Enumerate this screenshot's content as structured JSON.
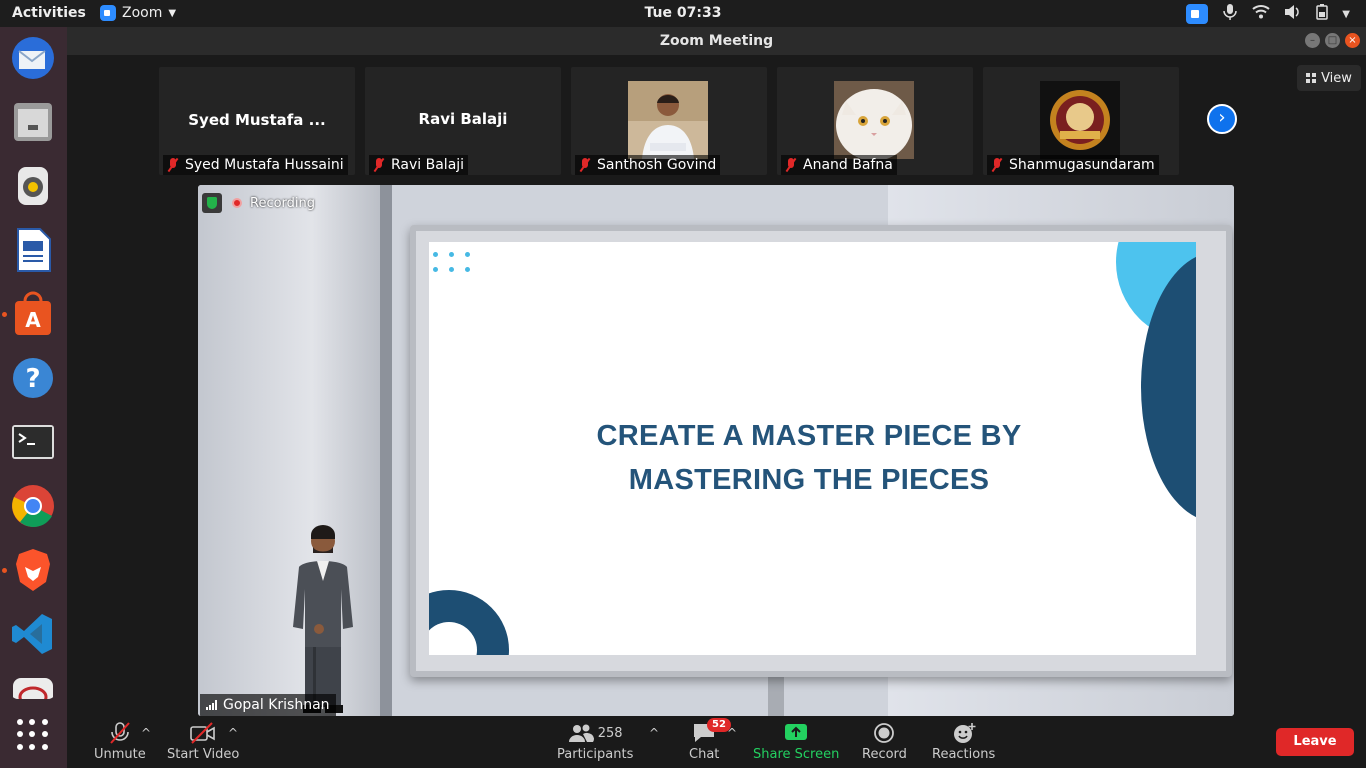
{
  "system_bar": {
    "activities": "Activities",
    "app_name": "Zoom",
    "clock": "Tue 07:33"
  },
  "window": {
    "title": "Zoom Meeting"
  },
  "view_button": "View",
  "participants_strip": [
    {
      "display_name": "Syed Mustafa ...",
      "label": "Syed Mustafa Hussaini",
      "muted": true
    },
    {
      "display_name": "Ravi Balaji",
      "label": "Ravi Balaji",
      "muted": true
    },
    {
      "display_name": "",
      "label": "Santhosh Govind",
      "muted": true
    },
    {
      "display_name": "",
      "label": "Anand Bafna",
      "muted": true
    },
    {
      "display_name": "",
      "label": "Shanmugasundaram",
      "muted": true
    }
  ],
  "stage": {
    "recording_label": "Recording",
    "slide_line1": "CREATE A MASTER PIECE BY",
    "slide_line2": "MASTERING THE PIECES",
    "speaker_name": "Gopal Krishnan"
  },
  "toolbar": {
    "unmute": "Unmute",
    "start_video": "Start Video",
    "participants_count": "258",
    "participants": "Participants",
    "chat": "Chat",
    "chat_badge": "52",
    "share_screen": "Share Screen",
    "record": "Record",
    "reactions": "Reactions",
    "leave": "Leave"
  },
  "colors": {
    "share_screen": "#23d160",
    "leave": "#e02828",
    "zoom_blue": "#2d8cff",
    "slide_text": "#24547a"
  }
}
